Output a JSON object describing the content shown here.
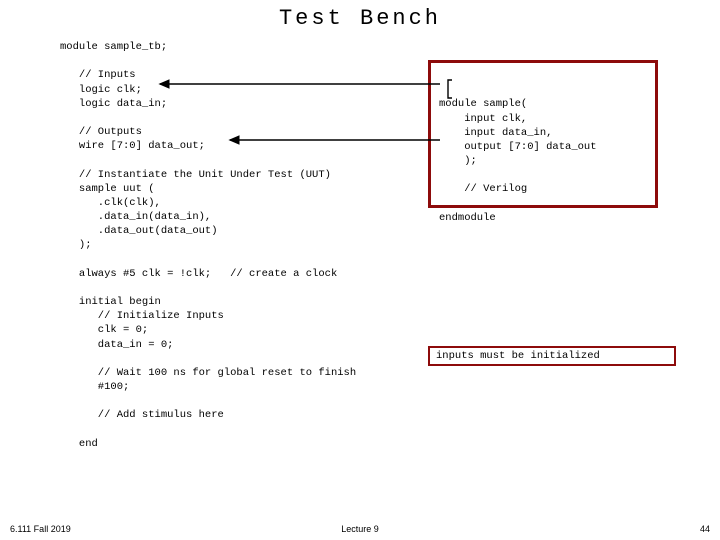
{
  "title": "Test Bench",
  "code_main": "module sample_tb;\n\n   // Inputs\n   logic clk;\n   logic data_in;\n\n   // Outputs\n   wire [7:0] data_out;\n\n   // Instantiate the Unit Under Test (UUT)\n   sample uut (\n      .clk(clk),\n      .data_in(data_in),\n      .data_out(data_out)\n   );\n\n   always #5 clk = !clk;   // create a clock\n\n   initial begin\n      // Initialize Inputs\n      clk = 0;\n      data_in = 0;\n\n      // Wait 100 ns for global reset to finish\n      #100;\n\n      // Add stimulus here\n\n   end",
  "code_module": "module sample(\n    input clk,\n    input data_in,\n    output [7:0] data_out\n    );\n\n    // Verilog\n\nendmodule",
  "note": "inputs must be initialized",
  "footer": {
    "left": "6.111 Fall 2019",
    "center": "Lecture 9",
    "right": "44"
  }
}
